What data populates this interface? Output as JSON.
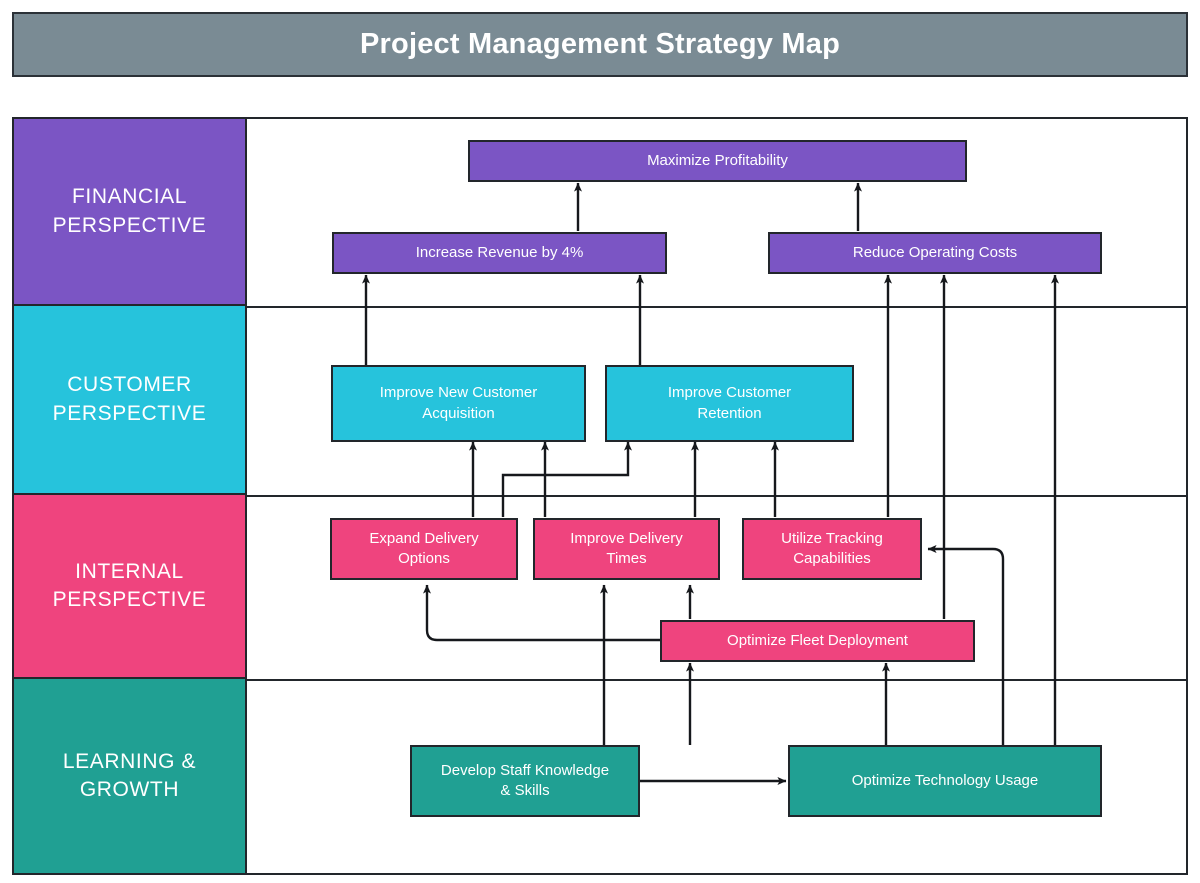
{
  "title": {
    "text": "Project Management Strategy Map",
    "banner_color": "#7A8B94",
    "text_color": "#FFFFFF"
  },
  "colors": {
    "financial": "#7B55C4",
    "customer": "#26C3DC",
    "internal": "#EF447E",
    "learning": "#20A093",
    "border": "#22262B",
    "background": "#FFFFFF"
  },
  "perspectives": [
    {
      "id": "financial",
      "label": "FINANCIAL\nPERSPECTIVE",
      "line1": "FINANCIAL",
      "line2": "PERSPECTIVE",
      "color": "#7B55C4"
    },
    {
      "id": "customer",
      "label": "CUSTOMER\nPERSPECTIVE",
      "line1": "CUSTOMER",
      "line2": "PERSPECTIVE",
      "color": "#26C3DC"
    },
    {
      "id": "internal",
      "label": "INTERNAL\nPERSPECTIVE",
      "line1": "INTERNAL",
      "line2": "PERSPECTIVE",
      "color": "#EF447E"
    },
    {
      "id": "learning",
      "label": "LEARNING &\nGROWTH",
      "line1": "LEARNING &",
      "line2": "GROWTH",
      "color": "#20A093"
    }
  ],
  "nodes": {
    "maximize_profitability": {
      "label": "Maximize Profitability",
      "perspective": "financial"
    },
    "increase_revenue": {
      "label": "Increase Revenue by 4%",
      "perspective": "financial"
    },
    "reduce_operating_costs": {
      "label": "Reduce Operating Costs",
      "perspective": "financial"
    },
    "improve_new_customer_acquisition": {
      "line1": "Improve New Customer",
      "line2": "Acquisition",
      "label": "Improve New Customer Acquisition",
      "perspective": "customer"
    },
    "improve_customer_retention": {
      "line1": "Improve Customer",
      "line2": "Retention",
      "label": "Improve Customer Retention",
      "perspective": "customer"
    },
    "expand_delivery_options": {
      "line1": "Expand Delivery",
      "line2": "Options",
      "label": "Expand Delivery Options",
      "perspective": "internal"
    },
    "improve_delivery_times": {
      "line1": "Improve Delivery",
      "line2": "Times",
      "label": "Improve Delivery Times",
      "perspective": "internal"
    },
    "utilize_tracking_capabilities": {
      "line1": "Utilize Tracking",
      "line2": "Capabilities",
      "label": "Utilize Tracking Capabilities",
      "perspective": "internal"
    },
    "optimize_fleet_deployment": {
      "label": "Optimize Fleet Deployment",
      "perspective": "internal"
    },
    "develop_staff_knowledge": {
      "line1": "Develop Staff Knowledge",
      "line2": "& Skills",
      "label": "Develop Staff Knowledge & Skills",
      "perspective": "learning"
    },
    "optimize_technology_usage": {
      "label": "Optimize Technology Usage",
      "perspective": "learning"
    }
  },
  "connections": [
    {
      "from": "increase_revenue",
      "to": "maximize_profitability"
    },
    {
      "from": "reduce_operating_costs",
      "to": "maximize_profitability"
    },
    {
      "from": "improve_new_customer_acquisition",
      "to": "increase_revenue"
    },
    {
      "from": "improve_customer_retention",
      "to": "increase_revenue"
    },
    {
      "from": "utilize_tracking_capabilities",
      "to": "reduce_operating_costs"
    },
    {
      "from": "optimize_fleet_deployment",
      "to": "reduce_operating_costs"
    },
    {
      "from": "optimize_technology_usage",
      "to": "reduce_operating_costs"
    },
    {
      "from": "expand_delivery_options",
      "to": "improve_new_customer_acquisition"
    },
    {
      "from": "improve_delivery_times",
      "to": "improve_new_customer_acquisition"
    },
    {
      "from": "expand_delivery_options",
      "to": "improve_customer_retention"
    },
    {
      "from": "improve_delivery_times",
      "to": "improve_customer_retention"
    },
    {
      "from": "utilize_tracking_capabilities",
      "to": "improve_customer_retention"
    },
    {
      "from": "optimize_fleet_deployment",
      "to": "expand_delivery_options"
    },
    {
      "from": "optimize_fleet_deployment",
      "to": "improve_delivery_times"
    },
    {
      "from": "optimize_technology_usage",
      "to": "utilize_tracking_capabilities"
    },
    {
      "from": "develop_staff_knowledge",
      "to": "improve_delivery_times"
    },
    {
      "from": "develop_staff_knowledge",
      "to": "optimize_fleet_deployment"
    },
    {
      "from": "develop_staff_knowledge",
      "to": "optimize_technology_usage"
    },
    {
      "from": "optimize_technology_usage",
      "to": "optimize_fleet_deployment"
    }
  ]
}
